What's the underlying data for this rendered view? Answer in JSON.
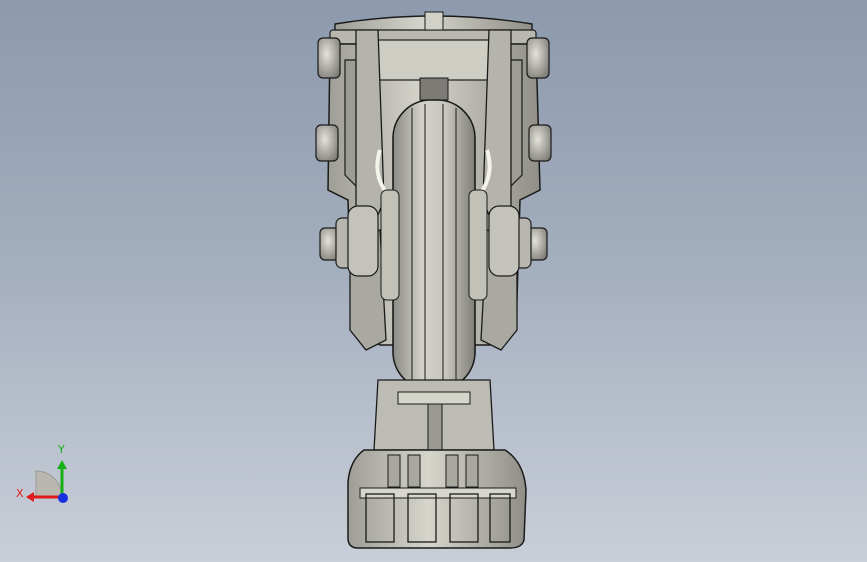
{
  "viewport": {
    "background_top": "#8d9aad",
    "background_bottom": "#c9cfd8",
    "model": {
      "part_color": "#c3c2b9",
      "part_shadow": "#8e8d86",
      "outline_color": "#1a1a1a",
      "wheel_color": "#b9b8b0"
    }
  },
  "triad": {
    "x_label": "X",
    "y_label": "Y",
    "x_color": "#e11a1a",
    "y_color": "#18b018",
    "z_color": "#1830e0",
    "icon": "coordinate-triad-icon"
  }
}
